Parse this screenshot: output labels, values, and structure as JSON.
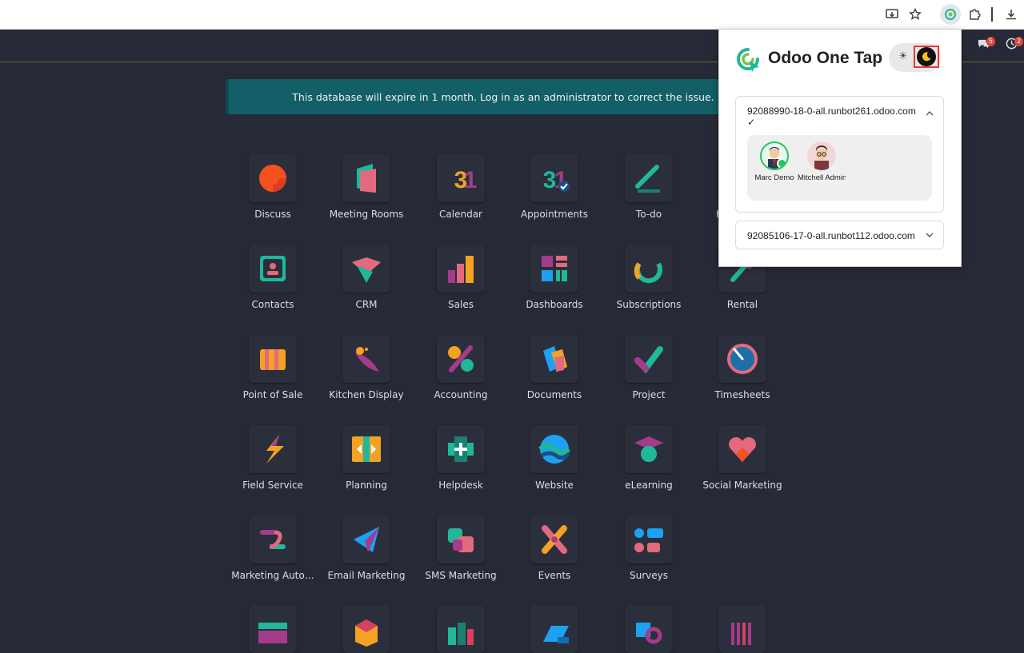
{
  "banner": {
    "text": "This database will expire in 1 month. Log in as an administrator to correct the issue."
  },
  "nav": {
    "messages_badge": "5",
    "activity_badge": "2"
  },
  "apps": [
    {
      "label": "Discuss",
      "icon": "discuss-icon"
    },
    {
      "label": "Meeting Rooms",
      "icon": "meeting-rooms-icon"
    },
    {
      "label": "Calendar",
      "icon": "calendar-icon"
    },
    {
      "label": "Appointments",
      "icon": "appointments-icon"
    },
    {
      "label": "To-do",
      "icon": "todo-icon"
    },
    {
      "label": "Knowledge",
      "icon": "knowledge-icon"
    },
    {
      "label": "Contacts",
      "icon": "contacts-icon"
    },
    {
      "label": "CRM",
      "icon": "crm-icon"
    },
    {
      "label": "Sales",
      "icon": "sales-icon"
    },
    {
      "label": "Dashboards",
      "icon": "dashboards-icon"
    },
    {
      "label": "Subscriptions",
      "icon": "subscriptions-icon"
    },
    {
      "label": "Rental",
      "icon": "rental-icon"
    },
    {
      "label": "Point of Sale",
      "icon": "point-of-sale-icon"
    },
    {
      "label": "Kitchen Display",
      "icon": "kitchen-display-icon"
    },
    {
      "label": "Accounting",
      "icon": "accounting-icon"
    },
    {
      "label": "Documents",
      "icon": "documents-icon"
    },
    {
      "label": "Project",
      "icon": "project-icon"
    },
    {
      "label": "Timesheets",
      "icon": "timesheets-icon"
    },
    {
      "label": "Field Service",
      "icon": "field-service-icon"
    },
    {
      "label": "Planning",
      "icon": "planning-icon"
    },
    {
      "label": "Helpdesk",
      "icon": "helpdesk-icon"
    },
    {
      "label": "Website",
      "icon": "website-icon"
    },
    {
      "label": "eLearning",
      "icon": "elearning-icon"
    },
    {
      "label": "Social Marketing",
      "icon": "social-marketing-icon"
    },
    {
      "label": "Marketing Auto…",
      "icon": "marketing-automation-icon"
    },
    {
      "label": "Email Marketing",
      "icon": "email-marketing-icon"
    },
    {
      "label": "SMS Marketing",
      "icon": "sms-marketing-icon"
    },
    {
      "label": "Events",
      "icon": "events-icon"
    },
    {
      "label": "Surveys",
      "icon": "surveys-icon"
    }
  ],
  "popup": {
    "title": "Odoo One Tap",
    "sun_glyph": "☀",
    "moon_glyph": "☾",
    "databases": [
      {
        "name": "92088990-18-0-all.runbot261.odoo.com",
        "check": "✓",
        "expanded": true,
        "users": [
          {
            "name": "Marc Demo",
            "online": true
          },
          {
            "name": "Mitchell Admin",
            "online": false
          }
        ]
      },
      {
        "name": "92085106-17-0-all.runbot112.odoo.com",
        "expanded": false
      }
    ]
  },
  "colors": {
    "background": "#262a36",
    "banner": "#135f67",
    "accent_red": "#e53935",
    "odoo_green": "#21b799"
  }
}
